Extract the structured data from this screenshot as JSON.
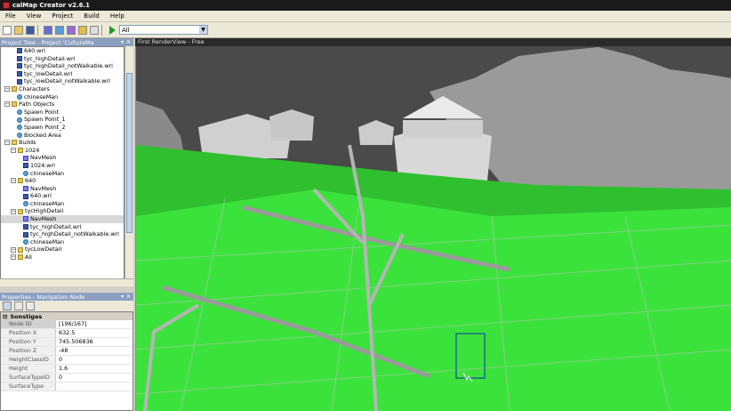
{
  "window": {
    "title": "calMap Creator v2.6.1"
  },
  "menu": [
    "File",
    "View",
    "Project",
    "Build",
    "Help"
  ],
  "toolbar": {
    "combo_value": "All"
  },
  "project_tree": {
    "title": "Project Tree - Project 'CultureMa",
    "items": [
      {
        "label": "640.wrl",
        "level": 2,
        "icon": "file"
      },
      {
        "label": "tyc_highDetail.wrl",
        "level": 2,
        "icon": "file"
      },
      {
        "label": "tyc_highDetail_notWalkable.wrl",
        "level": 2,
        "icon": "file"
      },
      {
        "label": "tyc_lowDetail.wrl",
        "level": 2,
        "icon": "file"
      },
      {
        "label": "tyc_lowDetail_notWalkable.wrl",
        "level": 2,
        "icon": "file"
      },
      {
        "label": "Characters",
        "level": 0,
        "icon": "folder"
      },
      {
        "label": "chineseMan",
        "level": 2,
        "icon": "obj"
      },
      {
        "label": "Path Objects",
        "level": 0,
        "icon": "folder"
      },
      {
        "label": "Spawn Point",
        "level": 2,
        "icon": "obj"
      },
      {
        "label": "Spawn Point_1",
        "level": 2,
        "icon": "obj"
      },
      {
        "label": "Spawn Point_2",
        "level": 2,
        "icon": "obj"
      },
      {
        "label": "Blocked Area",
        "level": 2,
        "icon": "obj"
      },
      {
        "label": "Builds",
        "level": 0,
        "icon": "folder"
      },
      {
        "label": "1024",
        "level": 1,
        "icon": "folder"
      },
      {
        "label": "NavMesh",
        "level": 3,
        "icon": "nav"
      },
      {
        "label": "1024.wrl",
        "level": 3,
        "icon": "file"
      },
      {
        "label": "chineseMan",
        "level": 3,
        "icon": "obj"
      },
      {
        "label": "640",
        "level": 1,
        "icon": "folder"
      },
      {
        "label": "NavMesh",
        "level": 3,
        "icon": "nav"
      },
      {
        "label": "640.wrl",
        "level": 3,
        "icon": "file"
      },
      {
        "label": "chineseMan",
        "level": 3,
        "icon": "obj"
      },
      {
        "label": "tycHighDetail",
        "level": 1,
        "icon": "folder"
      },
      {
        "label": "NavMesh",
        "level": 3,
        "icon": "nav",
        "selected": true
      },
      {
        "label": "tyc_highDetail.wrl",
        "level": 3,
        "icon": "file"
      },
      {
        "label": "tyc_highDetail_notWalkable.wrl",
        "level": 3,
        "icon": "file"
      },
      {
        "label": "chineseMan",
        "level": 3,
        "icon": "obj"
      },
      {
        "label": "tycLowDetail",
        "level": 1,
        "icon": "folder"
      },
      {
        "label": "All",
        "level": 1,
        "icon": "folder"
      }
    ]
  },
  "properties": {
    "title": "Properties - Navigation Node",
    "category": "Sonstiges",
    "rows": [
      {
        "key": "Node ID",
        "value": "[196/167]",
        "selected": true
      },
      {
        "key": "Position X",
        "value": "632.5"
      },
      {
        "key": "Position Y",
        "value": "745.506836"
      },
      {
        "key": "Position Z",
        "value": "-48"
      },
      {
        "key": "HeightClassID",
        "value": "0"
      },
      {
        "key": "Height",
        "value": "1.6"
      },
      {
        "key": "SurfaceTypeID",
        "value": "0"
      },
      {
        "key": "SurfaceType",
        "value": ""
      }
    ]
  },
  "render_view": {
    "title": "First RenderView - Free"
  },
  "colors": {
    "navmesh": "#3ee83e",
    "sky": "#4e4e4e",
    "selection_box": "#1a6a8a"
  }
}
